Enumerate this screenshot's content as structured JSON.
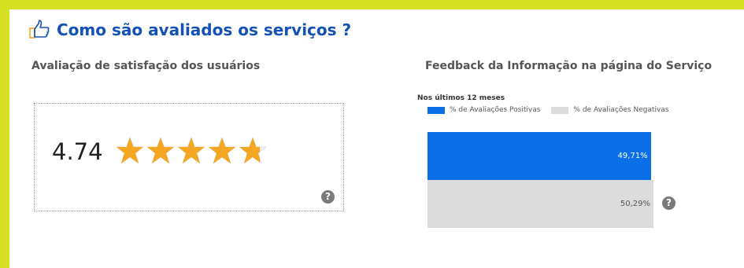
{
  "header": {
    "title": "Como são avaliados os serviços ?",
    "icon": "thumbs-up-icon"
  },
  "satisfaction": {
    "heading": "Avaliação de satisfação dos usuários",
    "rating_value": "4.74",
    "rating_numeric": 4.74,
    "rating_max": 5,
    "star_color": "#f5a623",
    "help_glyph": "?"
  },
  "feedback": {
    "heading": "Feedback da Informação na página do Serviço",
    "period": "Nos últimos 12 meses",
    "legend_positive": "% de Avaliações Positivas",
    "legend_negative": "% de Avaliações Negativas",
    "positive_label": "49,71%",
    "negative_label": "50,29%",
    "positive_color": "#0b6fe8",
    "negative_color": "#dcdcdc",
    "help_glyph": "?"
  },
  "chart_data": {
    "type": "bar",
    "categories": [
      "% de Avaliações Positivas",
      "% de Avaliações Negativas"
    ],
    "values": [
      49.71,
      50.29
    ],
    "title": "",
    "xlabel": "",
    "ylabel": "",
    "ylim": [
      0,
      50.29
    ]
  }
}
